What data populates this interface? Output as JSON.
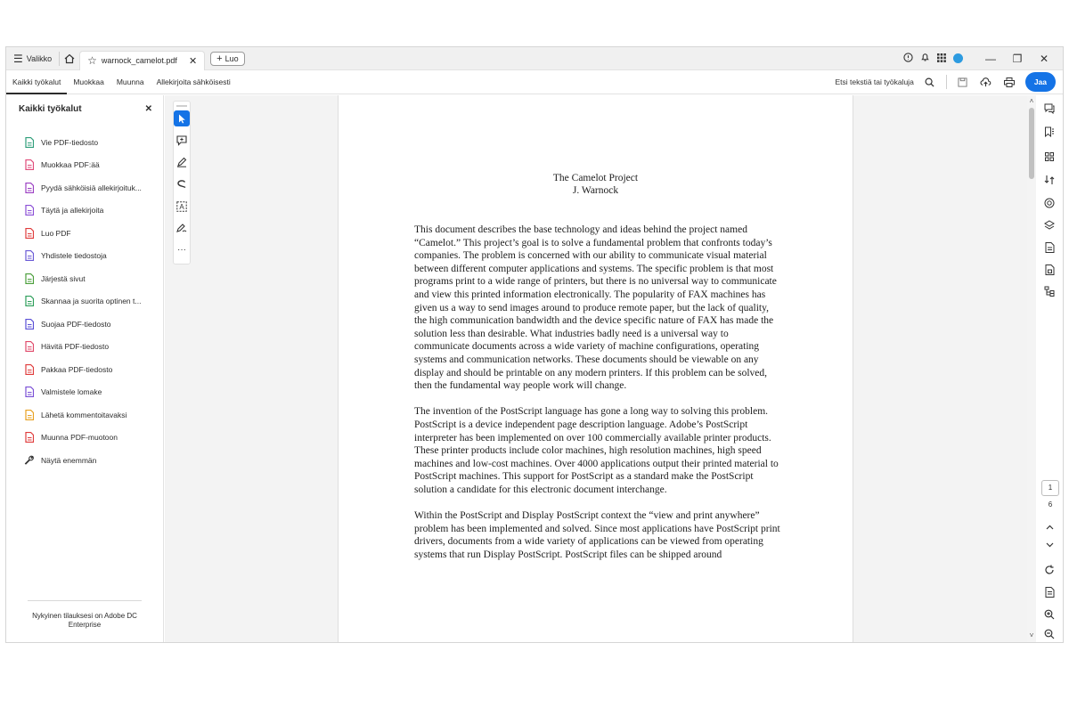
{
  "titlebar": {
    "menu_label": "Valikko",
    "tab_title": "warnock_camelot.pdf",
    "new_label": "Luo"
  },
  "toolbar": {
    "tabs": [
      "Kaikki työkalut",
      "Muokkaa",
      "Muunna",
      "Allekirjoita sähköisesti"
    ],
    "search_text": "Etsi tekstiä tai työkaluja",
    "share_label": "Jaa"
  },
  "left_panel": {
    "title": "Kaikki työkalut",
    "items": [
      {
        "label": "Vie PDF-tiedosto",
        "icon": "export-pdf-icon",
        "color": "#2f9e7a"
      },
      {
        "label": "Muokkaa PDF:ää",
        "icon": "edit-pdf-icon",
        "color": "#e04a79"
      },
      {
        "label": "Pyydä sähköisiä allekirjoituk...",
        "icon": "request-signature-icon",
        "color": "#9b3fc2"
      },
      {
        "label": "Täytä ja allekirjoita",
        "icon": "fill-sign-icon",
        "color": "#8b4fd6"
      },
      {
        "label": "Luo PDF",
        "icon": "create-pdf-icon",
        "color": "#e03c3c"
      },
      {
        "label": "Yhdistele tiedostoja",
        "icon": "combine-files-icon",
        "color": "#6a5ad6"
      },
      {
        "label": "Järjestä sivut",
        "icon": "organize-pages-icon",
        "color": "#4a9e3a"
      },
      {
        "label": "Skannaa ja suorita optinen t...",
        "icon": "scan-ocr-icon",
        "color": "#2d9e5a"
      },
      {
        "label": "Suojaa PDF-tiedosto",
        "icon": "protect-pdf-icon",
        "color": "#5a4fd6"
      },
      {
        "label": "Hävitä PDF-tiedosto",
        "icon": "redact-pdf-icon",
        "color": "#e04a6a"
      },
      {
        "label": "Pakkaa PDF-tiedosto",
        "icon": "compress-pdf-icon",
        "color": "#e03c3c"
      },
      {
        "label": "Valmistele lomake",
        "icon": "prepare-form-icon",
        "color": "#7a4fd6"
      },
      {
        "label": "Lähetä kommentoitavaksi",
        "icon": "send-comments-icon",
        "color": "#e8a020"
      },
      {
        "label": "Muunna PDF-muotoon",
        "icon": "convert-pdf-icon",
        "color": "#e03c3c"
      },
      {
        "label": "Näytä enemmän",
        "icon": "wrench-icon",
        "color": "#333333"
      }
    ],
    "footer": "Nykyinen tilauksesi on Adobe DC Enterprise"
  },
  "document": {
    "title_line1": "The Camelot Project",
    "title_line2": "J. Warnock",
    "paragraphs": [
      "This document describes the base technology and ideas behind the project named “Camelot.” This project’s goal is to solve a fundamental problem that confronts today’s companies. The problem is concerned with our ability to communicate visual material between different computer applications and systems. The specific problem is that most programs print to a wide range of printers, but there is no universal way to communicate and view this printed information electronically. The popularity of FAX machines has given us a way to send images around to produce remote paper, but the lack of quality, the high communication bandwidth and the device specific nature of FAX has made the solution less than desirable. What industries badly need is a universal way to communicate documents across a wide variety of machine configurations, operating systems and communication networks. These documents should be viewable on any display and should be printable on any modern printers. If this problem can be solved, then the fundamental way people work will change.",
      "The invention of the PostScript language has gone a long way to solving this problem. PostScript is a device independent page description language. Adobe’s PostScript interpreter has been implemented on over 100 commercially available printer products. These printer products include color machines, high resolution machines, high speed machines and low-cost machines. Over 4000 applications output their printed material to PostScript machines. This support for PostScript as a standard make the PostScript solution a candidate for this electronic document interchange.",
      "Within the PostScript and  Display PostScript context the “view and print anywhere” problem has been implemented and solved. Since most applications have PostScript print drivers, documents from a wide variety of applications can be viewed from operating systems that run Display PostScript. PostScript files can be shipped around"
    ]
  },
  "navigation": {
    "current_page": "1",
    "total_pages": "6"
  },
  "colors": {
    "accent": "#1473e6"
  }
}
